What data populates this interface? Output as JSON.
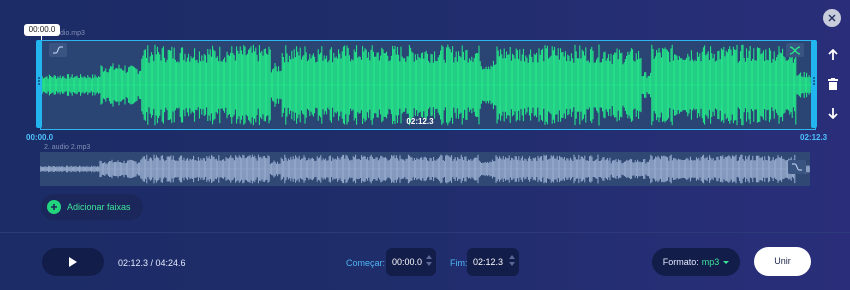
{
  "playhead": {
    "time": "00:00.0"
  },
  "tracks": [
    {
      "name": "1. audio.mp3",
      "visible_name": "dio.mp3",
      "waveform_color": "#23f08a",
      "selected": true,
      "mid_time": "02:12.3",
      "start_time": "00:00.0",
      "end_time": "02:12.3",
      "fade_in_icon": "fade-in-icon",
      "shuffle_icon": "shuffle-icon"
    },
    {
      "name": "2. audio 2.mp3",
      "waveform_color": "#9aaed0",
      "selected": false,
      "fade_icon": "fade-out-icon"
    }
  ],
  "side_actions": {
    "icons": [
      "arrow-up-icon",
      "trash-icon",
      "arrow-down-icon"
    ]
  },
  "close_icon": "close-icon",
  "add_tracks": {
    "label": "Adicionar faixas"
  },
  "footer": {
    "time_display": "02:12.3 / 04:24.6",
    "start_label": "Começar:",
    "start_value": "00:00.0",
    "end_label": "Fim:",
    "end_value": "02:12.3",
    "format_label": "Formato:",
    "format_value": "mp3",
    "join_label": "Unir"
  },
  "colors": {
    "accent_green": "#22d47c",
    "accent_blue": "#22b5f0",
    "background": "#1f2d6b"
  }
}
